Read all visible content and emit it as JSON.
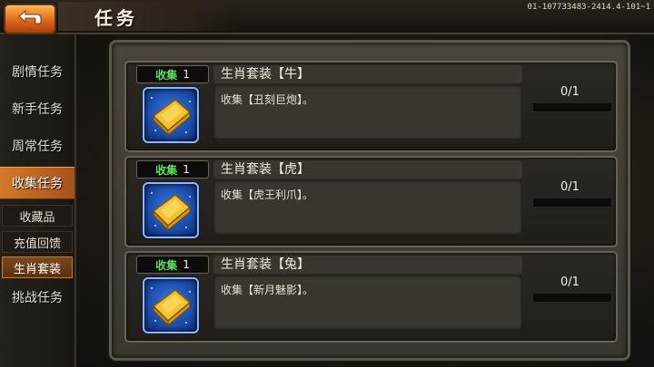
{
  "header": {
    "back_icon": "back-arrow-icon",
    "title": "任务",
    "version": "01-107733483-2414.4-101~1"
  },
  "sidebar": {
    "items": [
      {
        "label": "剧情任务",
        "active": false
      },
      {
        "label": "新手任务",
        "active": false
      },
      {
        "label": "周常任务",
        "active": false
      },
      {
        "label": "收集任务",
        "active": true
      },
      {
        "label": "挑战任务",
        "active": false
      }
    ],
    "subitems": [
      {
        "label": "收藏品",
        "active": false
      },
      {
        "label": "充值回馈",
        "active": false
      },
      {
        "label": "生肖套装",
        "active": true
      }
    ]
  },
  "quests": [
    {
      "tag": "收集",
      "tag_num": "1",
      "name": "生肖套装【牛】",
      "desc": "收集【丑刻巨炮】。",
      "progress": "0/1",
      "fraction": 0,
      "icon": "gold-bar-icon"
    },
    {
      "tag": "收集",
      "tag_num": "1",
      "name": "生肖套装【虎】",
      "desc": "收集【虎王利爪】。",
      "progress": "0/1",
      "fraction": 0,
      "icon": "gold-bar-icon"
    },
    {
      "tag": "收集",
      "tag_num": "1",
      "name": "生肖套装【兔】",
      "desc": "收集【新月魅影】。",
      "progress": "0/1",
      "fraction": 0,
      "icon": "gold-bar-icon"
    }
  ],
  "colors": {
    "accent": "#d27a2a",
    "tag_green": "#5be35b",
    "icon_blue": "#1c4fb0",
    "gold": "#f2c230"
  }
}
